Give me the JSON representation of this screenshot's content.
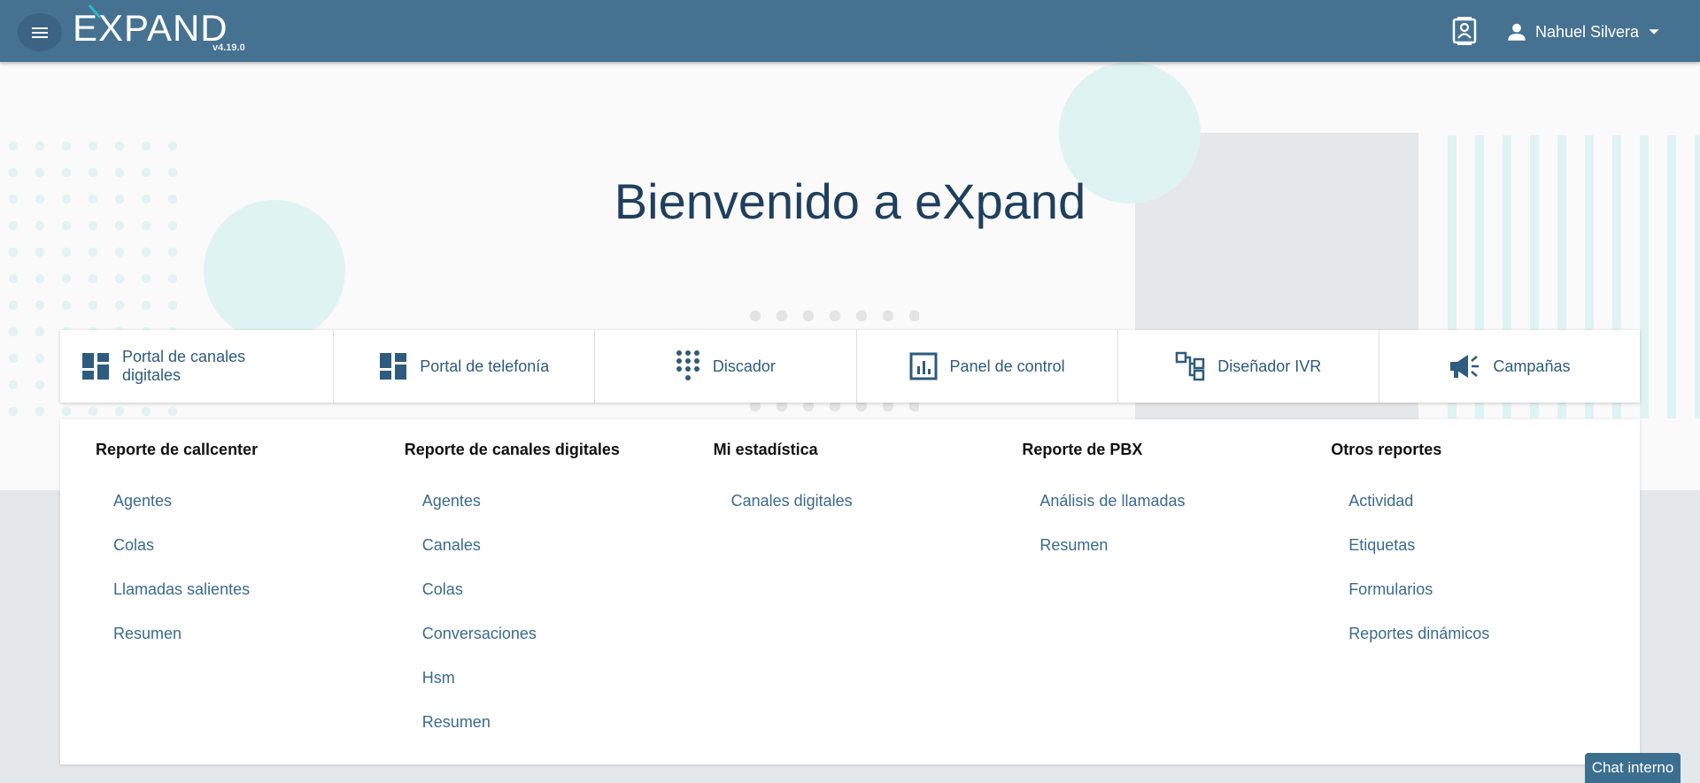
{
  "header": {
    "logo": "EXPAND",
    "version": "v4.19.0",
    "user_name": "Nahuel Silvera"
  },
  "welcome": "Bienvenido a eXpand",
  "portals": [
    {
      "label": "Portal de canales digitales",
      "icon": "dashboard-icon"
    },
    {
      "label": "Portal de telefonía",
      "icon": "dashboard-icon"
    },
    {
      "label": "Discador",
      "icon": "dialpad-icon"
    },
    {
      "label": "Panel de control",
      "icon": "analytics-icon"
    },
    {
      "label": "Diseñador IVR",
      "icon": "flow-icon"
    },
    {
      "label": "Campañas",
      "icon": "megaphone-icon"
    }
  ],
  "reports": [
    {
      "title": "Reporte de callcenter",
      "links": [
        "Agentes",
        "Colas",
        "Llamadas salientes",
        "Resumen"
      ]
    },
    {
      "title": "Reporte de canales digitales",
      "links": [
        "Agentes",
        "Canales",
        "Colas",
        "Conversaciones",
        "Hsm",
        "Resumen"
      ]
    },
    {
      "title": "Mi estadística",
      "links": [
        "Canales digitales"
      ]
    },
    {
      "title": "Reporte de PBX",
      "links": [
        "Análisis de llamadas",
        "Resumen"
      ]
    },
    {
      "title": "Otros reportes",
      "links": [
        "Actividad",
        "Etiquetas",
        "Formularios",
        "Reportes dinámicos"
      ]
    }
  ],
  "chat_label": "Chat interno",
  "colors": {
    "header": "#467291",
    "accent": "#2e5b7e",
    "link": "#3a6a8f"
  }
}
